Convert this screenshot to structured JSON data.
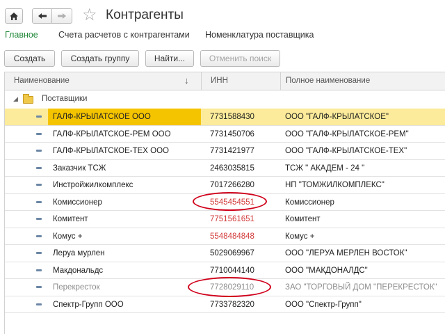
{
  "window": {
    "title": "Контрагенты",
    "icons": [
      "home-icon",
      "arrow-left-icon",
      "arrow-right-icon",
      "star-icon"
    ]
  },
  "tabs": [
    {
      "label": "Главное",
      "active": true
    },
    {
      "label": "Счета расчетов с контрагентами",
      "active": false
    },
    {
      "label": "Номенклатура поставщика",
      "active": false
    }
  ],
  "toolbar": {
    "create_label": "Создать",
    "create_group_label": "Создать группу",
    "find_label": "Найти...",
    "cancel_search_label": "Отменить поиск"
  },
  "table": {
    "columns": [
      "Наименование",
      "ИНН",
      "Полное наименование"
    ],
    "group": {
      "label": "Поставщики",
      "icon": "folder-icon"
    },
    "rows": [
      {
        "name": "ГАЛФ-КРЫЛАТСКОЕ ООО",
        "inn": "7731588430",
        "full": "ООО \"ГАЛФ-КРЫЛАТСКОЕ\""
      },
      {
        "name": "ГАЛФ-КРЫЛАТСКОЕ-РЕМ ООО",
        "inn": "7731450706",
        "full": "ООО \"ГАЛФ-КРЫЛАТСКОЕ-РЕМ\""
      },
      {
        "name": "ГАЛФ-КРЫЛАТСКОЕ-ТЕХ ООО",
        "inn": "7731421977",
        "full": "ООО \"ГАЛФ-КРЫЛАТСКОЕ-ТЕХ\""
      },
      {
        "name": "Заказчик ТСЖ",
        "inn": "2463035815",
        "full": "ТСЖ \" АКАДЕМ - 24 \""
      },
      {
        "name": "Инстройжилкомплекс",
        "inn": "7017266280",
        "full": "НП \"ТОМЖИЛКОМПЛЕКС\""
      },
      {
        "name": "Комиссионер",
        "inn": "5545454551",
        "full": "Комиссионер"
      },
      {
        "name": "Комитент",
        "inn": "7751561651",
        "full": "Комитент"
      },
      {
        "name": "Комус +",
        "inn": "5548484848",
        "full": "Комус +"
      },
      {
        "name": "Леруа мурлен",
        "inn": "5029069967",
        "full": "ООО \"ЛЕРУА МЕРЛЕН ВОСТОК\""
      },
      {
        "name": "Макдональдс",
        "inn": "7710044140",
        "full": "ООО \"МАКДОНАЛДС\""
      },
      {
        "name": "Перекресток",
        "inn": "7728029110",
        "full": "ЗАО \"ТОРГОВЫЙ ДОМ \"ПЕРЕКРЕСТОК\""
      },
      {
        "name": "Спектр-Групп ООО",
        "inn": "7733782320",
        "full": "ООО \"Спектр-Групп\""
      }
    ]
  },
  "colors": {
    "active_tab": "#22883a",
    "selected_row": "#fbeb9a",
    "selected_cell": "#f5c400",
    "invalid_inn": "#d43c3c",
    "highlight_ellipse": "#d0001b"
  }
}
